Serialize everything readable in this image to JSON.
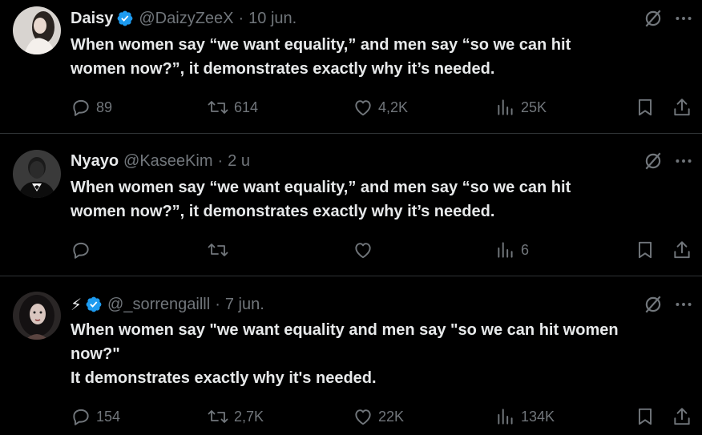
{
  "tweets": [
    {
      "name": "Daisy",
      "verified": true,
      "handle": "@DaizyZeeX",
      "separator": "·",
      "time": "10 jun.",
      "text": "When women say “we want equality,” and men say “so we can hit\nwomen now?”, it demonstrates exactly why it’s needed.",
      "replies": "89",
      "reposts": "614",
      "likes": "4,2K",
      "views": "25K"
    },
    {
      "name": "Nyayo",
      "verified": false,
      "handle": "@KaseeKim",
      "separator": "·",
      "time": "2 u",
      "text": "When women say “we want equality,” and men say “so we can hit\nwomen now?”, it demonstrates exactly why it’s needed.",
      "replies": "",
      "reposts": "",
      "likes": "",
      "views": "6"
    },
    {
      "name": "⚡",
      "verified": true,
      "handle": "@_sorrengailll",
      "separator": "·",
      "time": "7 jun.",
      "text": "When women say \"we want equality and men say \"so we can hit women\nnow?\"\nIt demonstrates exactly why it's needed.",
      "replies": "154",
      "reposts": "2,7K",
      "likes": "22K",
      "views": "134K"
    }
  ],
  "icons": {
    "reply": "reply-icon",
    "repost": "repost-icon",
    "like": "heart-icon",
    "views": "views-icon",
    "bookmark": "bookmark-icon",
    "share": "share-icon",
    "grok": "grok-icon",
    "more": "more-icon"
  },
  "colors": {
    "background": "#000000",
    "text": "#e7e9ea",
    "muted": "#71767b",
    "verified": "#1d9bf0",
    "divider": "#2f3336"
  }
}
